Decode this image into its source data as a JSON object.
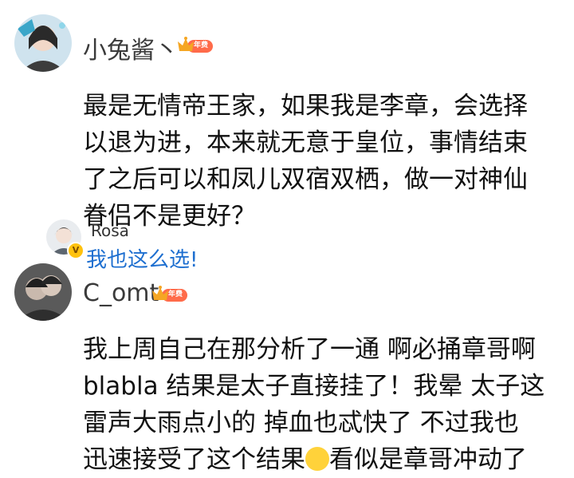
{
  "comments": [
    {
      "username": "小兔酱丶",
      "badge": "年费",
      "lines": [
        "最是无情帝王家，如果我是李章，会选择",
        "以退为进，本来就无意于皇位，事情结束",
        "了之后可以和凤儿双宿双栖，做一对神仙",
        "眷侣不是更好？"
      ],
      "reply": {
        "username": "Rosa",
        "verified_mark": "V",
        "text": "我也这么选!"
      }
    },
    {
      "username": "C_omt",
      "badge": "年费",
      "lines": [
        "我上周自己在那分析了一通 啊必捅章哥啊",
        "blabla 结果是太子直接挂了！我晕 太子这",
        "雷声大雨点小的 掉血也忒快了 不过我也",
        "迅速接受了这个结果",
        "看似是章哥冲动了"
      ]
    }
  ],
  "colors": {
    "reply_link": "#1e6fd0",
    "badge_gold": "#f5a623",
    "badge_red": "#ff6b4a",
    "verified_yellow": "#ffc20e"
  },
  "icons": {
    "crown": "crown-icon",
    "verified": "verified-v-icon",
    "emoji": "smile-emoji"
  }
}
